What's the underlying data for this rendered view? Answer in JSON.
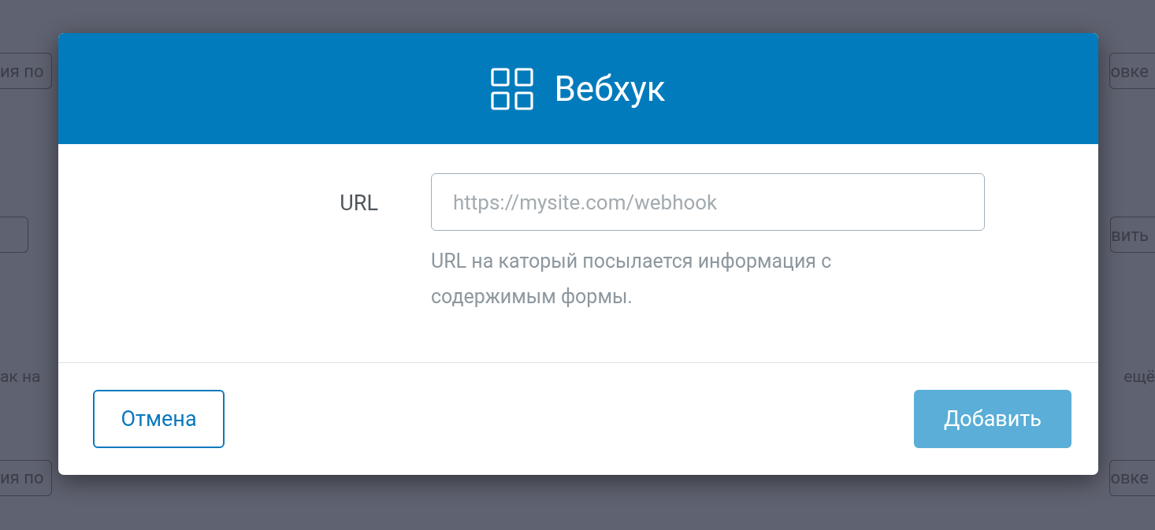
{
  "background": {
    "left": [
      {
        "kind": "button",
        "text": "ия по"
      },
      {
        "kind": "button"
      },
      {
        "kind": "text",
        "text": "ак на"
      },
      {
        "kind": "button",
        "text": "ия по"
      }
    ],
    "right": [
      {
        "kind": "button",
        "text": "овке"
      },
      {
        "kind": "button",
        "text": "вить"
      },
      {
        "kind": "text",
        "text": "ещё"
      },
      {
        "kind": "button",
        "text": "овке"
      }
    ]
  },
  "dialog": {
    "title": "Вебхук",
    "field": {
      "label": "URL",
      "placeholder": "https://mysite.com/webhook",
      "hint": "URL на каторый посылается информация с содержимым формы."
    },
    "buttons": [
      {
        "kind": "secondary",
        "label": "Отмена"
      },
      {
        "kind": "primary",
        "label": "Добавить"
      }
    ]
  }
}
